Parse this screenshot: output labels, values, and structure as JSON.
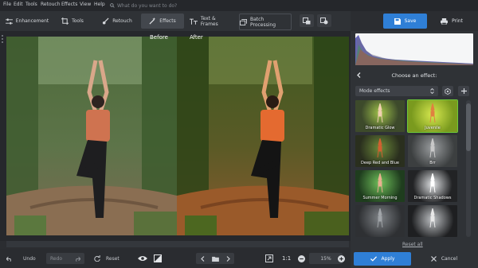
{
  "menu": [
    "File",
    "Edit",
    "Tools",
    "Retouch",
    "Effects",
    "View",
    "Help"
  ],
  "search": {
    "placeholder": "What do you want to do?"
  },
  "toolbar": {
    "enhancement": "Enhancement",
    "tools": "Tools",
    "retouch": "Retouch",
    "effects": "Effects",
    "text_frames": "Text & Frames",
    "batch": "Batch Processing"
  },
  "actions": {
    "save": "Save",
    "print": "Print"
  },
  "compare": {
    "before": "Before",
    "after": "After"
  },
  "bottom": {
    "undo": "Undo",
    "redo": "Redo",
    "reset": "Reset",
    "ratio": "1:1",
    "zoom": "15%"
  },
  "panel": {
    "title": "Choose an effect:",
    "dropdown": "Mode effects",
    "effects": [
      {
        "name": "Dramatic Glow",
        "bg": "#3d4a2b",
        "fg": "#9fc24a"
      },
      {
        "name": "Juvenile",
        "bg": "#7a9a1e",
        "fg": "#d7e84f"
      },
      {
        "name": "Deep Red and Blue",
        "bg": "#2a2f1e",
        "fg": "#6c8a3a"
      },
      {
        "name": "Brr",
        "bg": "#3c3f40",
        "fg": "#9a9d9f"
      },
      {
        "name": "Summer Morning",
        "bg": "#1f3d1e",
        "fg": "#6fbf5a"
      },
      {
        "name": "Dramatic Shadows",
        "bg": "#222325",
        "fg": "#e0e2e4"
      },
      {
        "name": "",
        "bg": "#2e3033",
        "fg": "#7d8185"
      },
      {
        "name": "",
        "bg": "#1e1f21",
        "fg": "#bfc2c5"
      }
    ],
    "reset": "Reset all",
    "apply": "Apply",
    "cancel": "Cancel"
  }
}
